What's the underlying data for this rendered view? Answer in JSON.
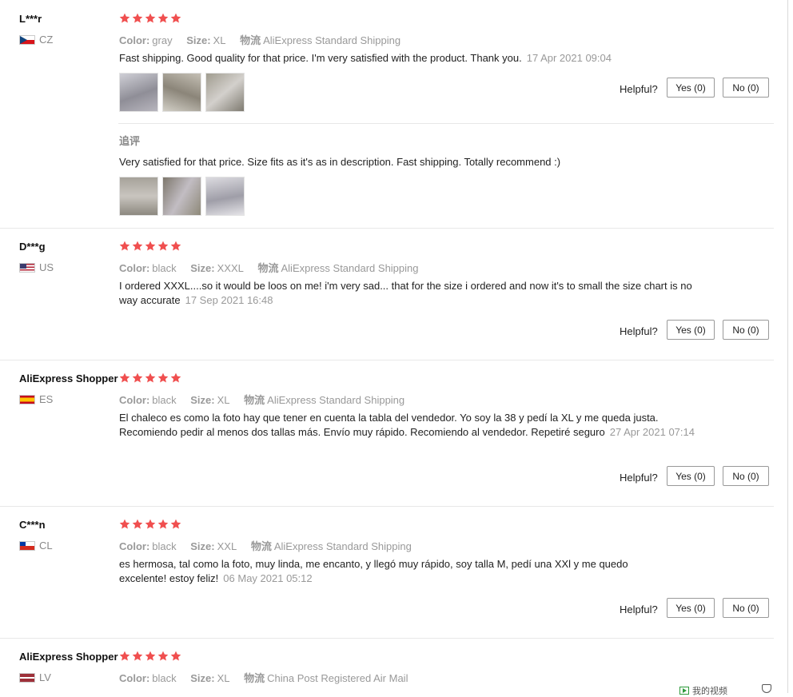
{
  "helpful_label": "Helpful?",
  "labels": {
    "color": "Color:",
    "size": "Size:",
    "shipping": "物流"
  },
  "colors": {
    "star": "#f04f4f",
    "accent_text": "#999999"
  },
  "reviews": [
    {
      "user": "L***r",
      "country": "CZ",
      "rating": 5,
      "color": "gray",
      "size": "XL",
      "shipping": "AliExpress Standard Shipping",
      "text": "Fast shipping. Good quality for that price. I'm very satisfied with the product. Thank you.",
      "date": "17 Apr 2021 09:04",
      "yes": "Yes (0)",
      "no": "No (0)",
      "followup_label": "追评",
      "followup_text": "Very satisfied for that price. Size fits as it's as in description. Fast shipping. Totally recommend :)"
    },
    {
      "user": "D***g",
      "country": "US",
      "rating": 5,
      "color": "black",
      "size": "XXXL",
      "shipping": "AliExpress Standard Shipping",
      "text": "I ordered XXXL....so it would be loos on me! i'm very sad... that for the size i ordered and now it's to small the size chart is no way accurate",
      "date": "17 Sep 2021 16:48",
      "yes": "Yes (0)",
      "no": "No (0)"
    },
    {
      "user": "AliExpress Shopper",
      "country": "ES",
      "rating": 5,
      "color": "black",
      "size": "XL",
      "shipping": "AliExpress Standard Shipping",
      "text": "El chaleco es como la foto hay que tener en cuenta la tabla del vendedor. Yo soy la 38 y pedí la XL y me queda justa. Recomiendo pedir al menos dos tallas más. Envío muy rápido. Recomiendo al vendedor. Repetiré seguro",
      "date": "27 Apr 2021 07:14",
      "yes": "Yes (0)",
      "no": "No (0)"
    },
    {
      "user": "C***n",
      "country": "CL",
      "rating": 5,
      "color": "black",
      "size": "XXL",
      "shipping": "AliExpress Standard Shipping",
      "text": "es hermosa, tal como la foto, muy linda, me encanto, y llegó muy rápido, soy talla M, pedí una XXl y me quedo excelente! estoy feliz!",
      "date": "06 May 2021 05:12",
      "yes": "Yes (0)",
      "no": "No (0)"
    },
    {
      "user": "AliExpress Shopper",
      "country": "LV",
      "rating": 5,
      "color": "black",
      "size": "XL",
      "shipping": "China Post Registered Air Mail"
    }
  ],
  "bottom_bar": {
    "video_label": "我的视频"
  }
}
